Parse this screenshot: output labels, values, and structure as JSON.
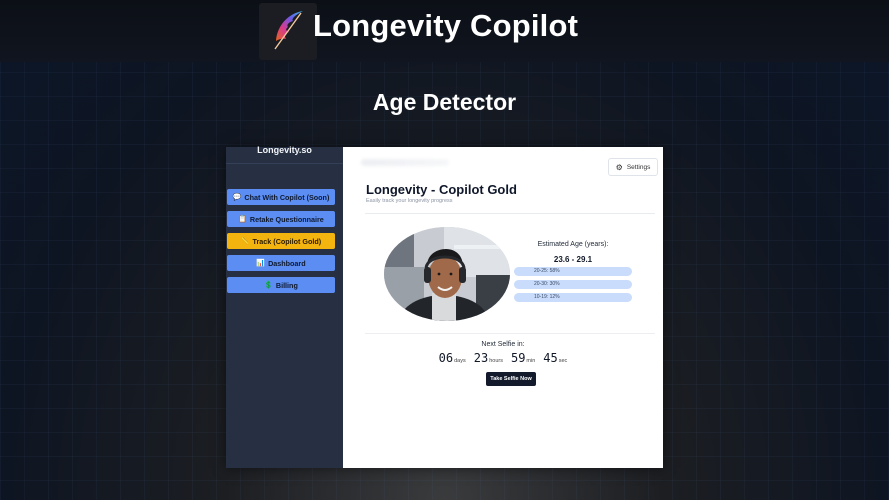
{
  "brand": {
    "title": "Longevity Copilot",
    "logo": "feather-logo"
  },
  "page": {
    "heading": "Age Detector"
  },
  "app": {
    "sidebar": {
      "brand": "Longevity.so",
      "items": [
        {
          "icon": "💬",
          "label": "Chat With Copilot (Soon)",
          "active": false
        },
        {
          "icon": "📋",
          "label": "Retake Questionnaire",
          "active": false
        },
        {
          "icon": "📏",
          "label": "Track (Copilot Gold)",
          "active": true
        },
        {
          "icon": "📊",
          "label": "Dashboard",
          "active": false
        },
        {
          "icon": "💲",
          "label": "Billing",
          "active": false
        }
      ]
    },
    "main": {
      "settings_label": "Settings",
      "title": "Longevity - Copilot Gold",
      "subtitle": "Easily track your longevity progress",
      "estimate": {
        "label": "Estimated Age (years):",
        "value": "23.6 - 29.1",
        "ranges": [
          {
            "label": "20-25: 58%"
          },
          {
            "label": "20-30: 30%"
          },
          {
            "label": "10-19: 12%"
          }
        ]
      },
      "countdown": {
        "label": "Next Selfie in:",
        "days": "06",
        "days_unit": "days",
        "hours": "23",
        "hours_unit": "hours",
        "minutes": "59",
        "minutes_unit": "min",
        "seconds": "45",
        "seconds_unit": "sec"
      },
      "take_selfie_label": "Take Selfie Now"
    }
  },
  "colors": {
    "sidebar_bg": "#263042",
    "button_blue": "#5b8df2",
    "button_gold": "#f4b40f",
    "pill_blue": "#c9dcfb",
    "dark_button": "#121a2c"
  }
}
